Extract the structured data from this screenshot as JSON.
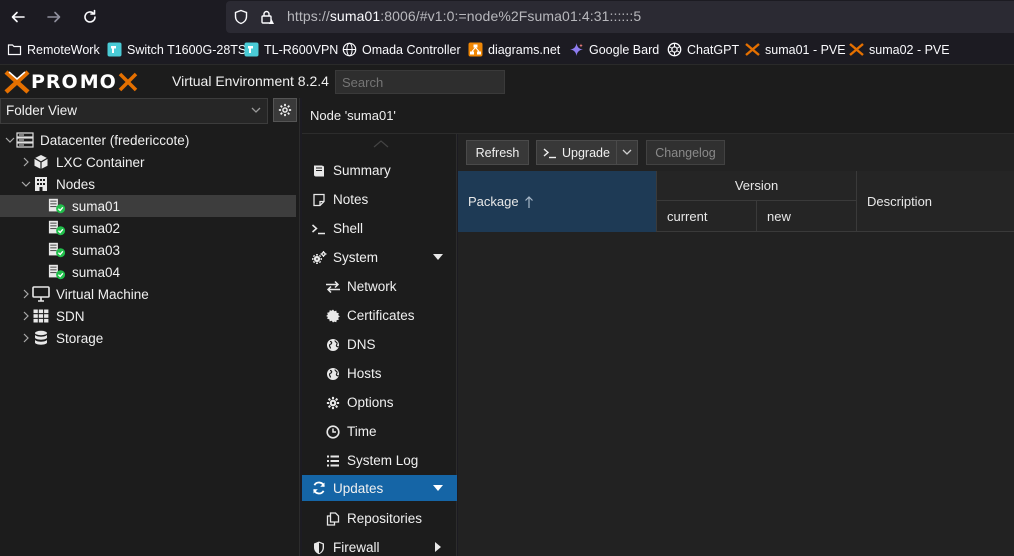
{
  "browser": {
    "url_prefix": "https://",
    "url_host": "suma01",
    "url_rest": ":8006/#v1:0:=node%2Fsuma01:4:31::::::5"
  },
  "bookmarks": [
    {
      "label": "RemoteWork",
      "icon": "folder-icon"
    },
    {
      "label": "Switch T1600G-28TS",
      "icon": "tplink-icon"
    },
    {
      "label": "TL-R600VPN",
      "icon": "tplink-icon"
    },
    {
      "label": "Omada Controller",
      "icon": "globe-icon"
    },
    {
      "label": "diagrams.net",
      "icon": "drawio-icon"
    },
    {
      "label": "Google Bard",
      "icon": "bard-icon"
    },
    {
      "label": "ChatGPT",
      "icon": "chatgpt-icon"
    },
    {
      "label": "suma01 - PVE",
      "icon": "proxmox-icon"
    },
    {
      "label": "suma02 - PVE",
      "icon": "proxmox-icon"
    }
  ],
  "header": {
    "logo_left": "PRO",
    "logo_right": "MO",
    "version": "Virtual Environment 8.2.4",
    "search_placeholder": "Search"
  },
  "tree": {
    "view": "Folder View",
    "items": [
      {
        "label": "Datacenter (fredericcote)",
        "icon": "datacenter-icon"
      },
      {
        "label": "LXC Container",
        "icon": "cube-icon"
      },
      {
        "label": "Nodes",
        "icon": "building-icon"
      },
      {
        "label": "suma01",
        "icon": "server-online-icon"
      },
      {
        "label": "suma02",
        "icon": "server-online-icon"
      },
      {
        "label": "suma03",
        "icon": "server-online-icon"
      },
      {
        "label": "suma04",
        "icon": "server-online-icon"
      },
      {
        "label": "Virtual Machine",
        "icon": "desktop-icon"
      },
      {
        "label": "SDN",
        "icon": "grid-icon"
      },
      {
        "label": "Storage",
        "icon": "database-icon"
      }
    ]
  },
  "node_title": "Node 'suma01'",
  "menu": [
    {
      "label": "Summary",
      "icon": "book-icon"
    },
    {
      "label": "Notes",
      "icon": "note-icon"
    },
    {
      "label": "Shell",
      "icon": "terminal-icon"
    },
    {
      "label": "System",
      "icon": "cogs-icon"
    },
    {
      "label": "Network",
      "icon": "exchange-icon"
    },
    {
      "label": "Certificates",
      "icon": "certificate-icon"
    },
    {
      "label": "DNS",
      "icon": "globe-icon"
    },
    {
      "label": "Hosts",
      "icon": "globe-icon"
    },
    {
      "label": "Options",
      "icon": "gear-icon"
    },
    {
      "label": "Time",
      "icon": "clock-icon"
    },
    {
      "label": "System Log",
      "icon": "list-icon"
    },
    {
      "label": "Updates",
      "icon": "refresh-icon"
    },
    {
      "label": "Repositories",
      "icon": "files-icon"
    },
    {
      "label": "Firewall",
      "icon": "shield-icon"
    }
  ],
  "toolbar": {
    "refresh": "Refresh",
    "upgrade": "Upgrade",
    "changelog": "Changelog"
  },
  "grid": {
    "package": "Package",
    "version": "Version",
    "current": "current",
    "new": "new",
    "description": "Description"
  }
}
